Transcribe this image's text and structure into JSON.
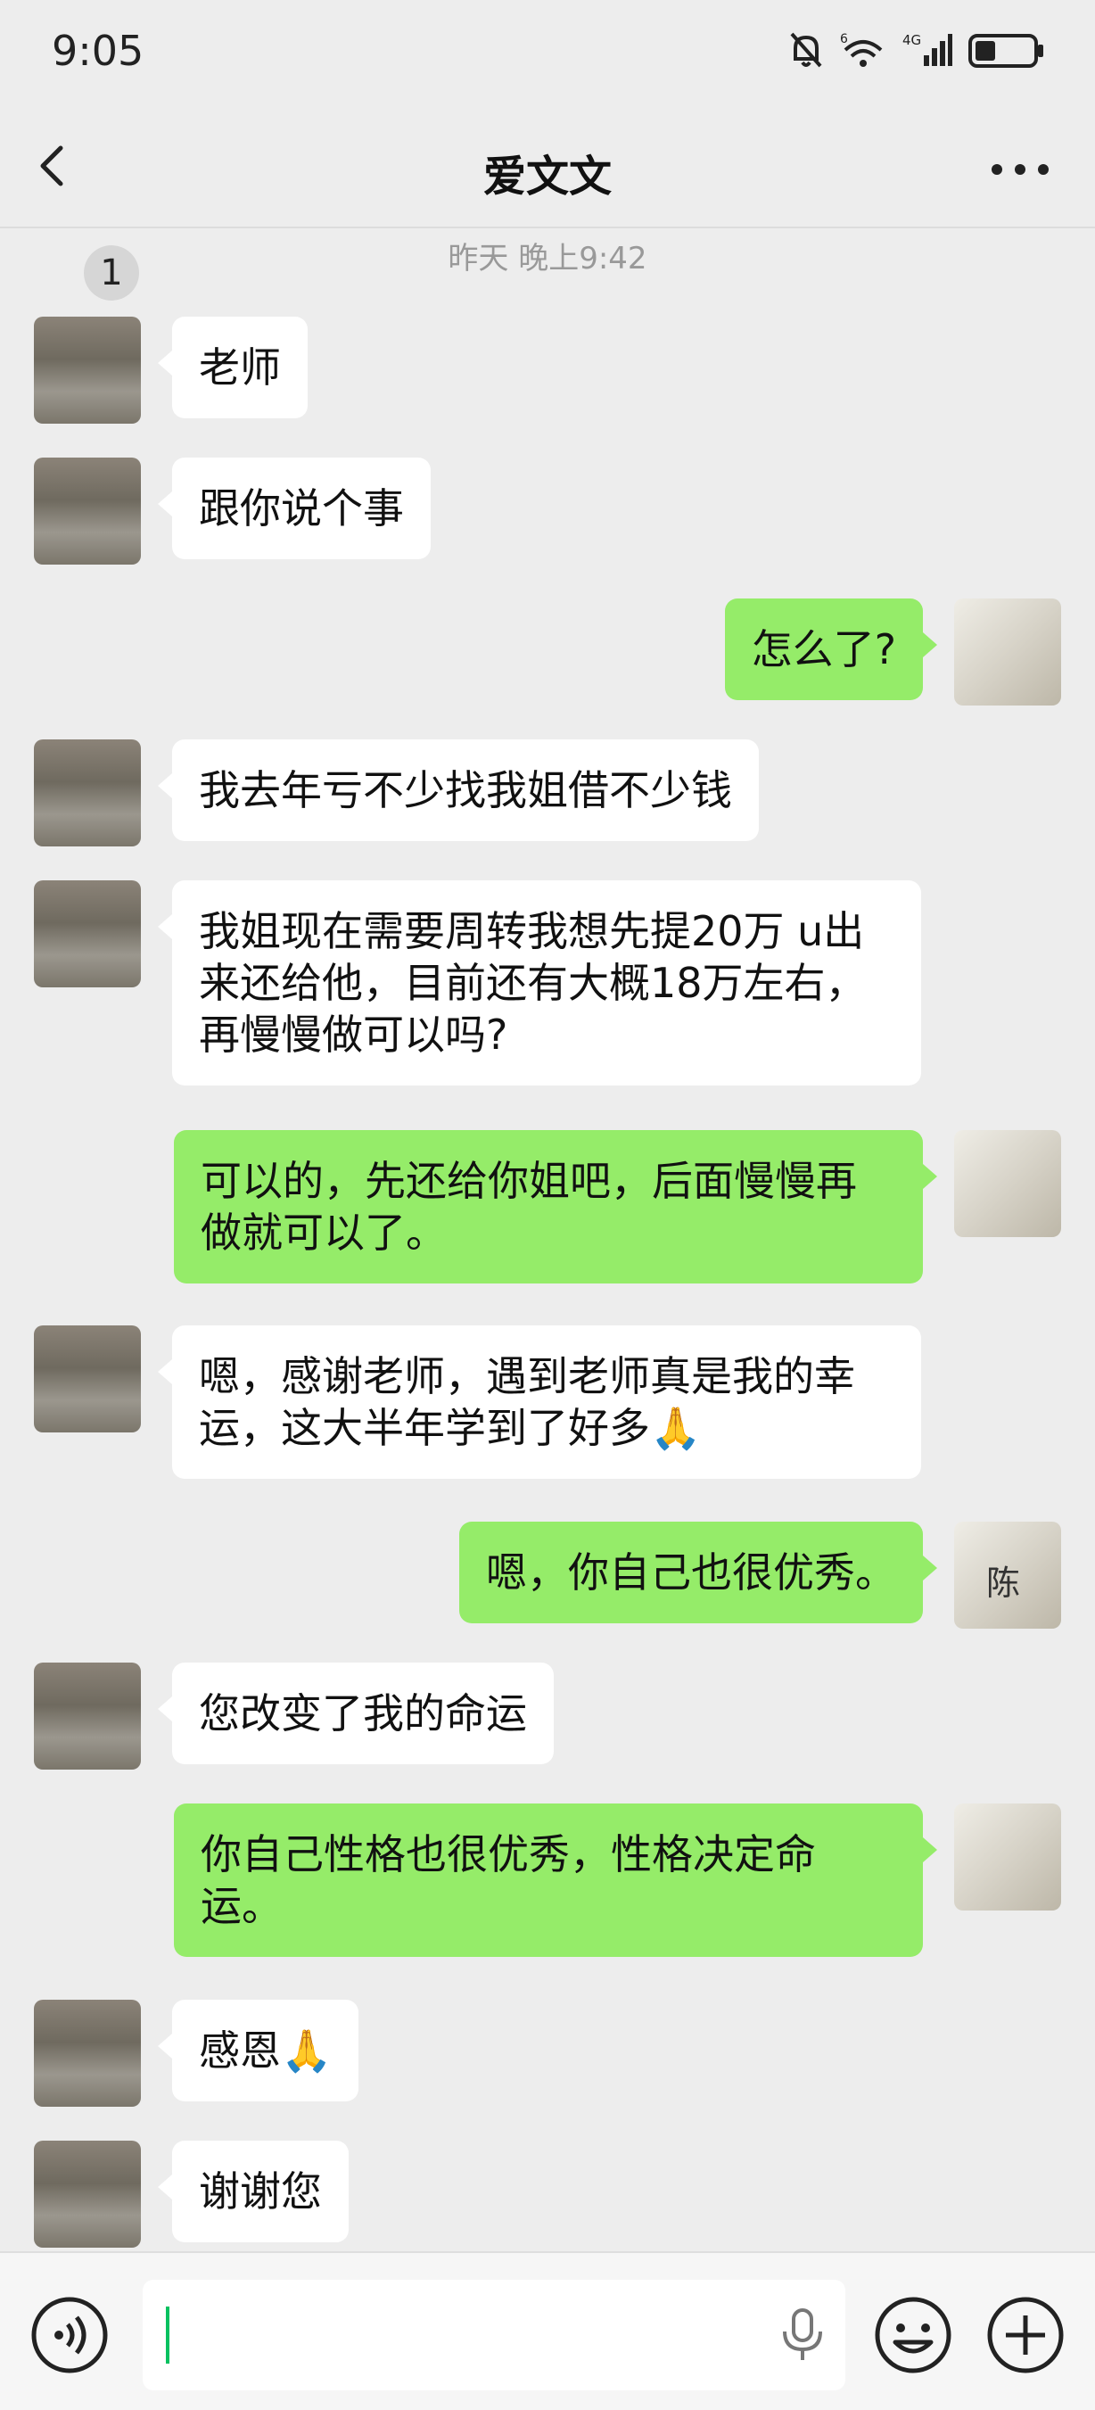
{
  "status_bar": {
    "time": "9:05",
    "battery_level": 0.35
  },
  "header": {
    "unread_count": "1",
    "title": "爱文文"
  },
  "timestamp": "昨天 晚上9:42",
  "messages": [
    {
      "side": "left",
      "text": "老师"
    },
    {
      "side": "left",
      "text": "跟你说个事"
    },
    {
      "side": "right",
      "text": "怎么了?"
    },
    {
      "side": "left",
      "text": "我去年亏不少找我姐借不少钱"
    },
    {
      "side": "left",
      "text": "我姐现在需要周转我想先提20万 u出来还给他，目前还有大概18万左右，再慢慢做可以吗?"
    },
    {
      "side": "right",
      "text": "可以的，先还给你姐吧，后面慢慢再做就可以了。"
    },
    {
      "side": "left",
      "text": "嗯，感谢老师，遇到老师真是我的幸运，这大半年学到了好多🙏"
    },
    {
      "side": "right",
      "text": "嗯，你自己也很优秀。"
    },
    {
      "side": "left",
      "text": "您改变了我的命运"
    },
    {
      "side": "right",
      "text": "你自己性格也很优秀，性格决定命运。"
    },
    {
      "side": "left",
      "text": "感恩🙏"
    },
    {
      "side": "left",
      "text": "谢谢您"
    }
  ],
  "right_avatar_char": "陈",
  "icons": {
    "back": "chevron-left-icon",
    "more": "more-dots-icon",
    "voice": "voice-icon",
    "mic": "microphone-icon",
    "emoji": "emoji-icon",
    "plus": "plus-icon"
  },
  "colors": {
    "sent_bubble": "#95ec69",
    "received_bubble": "#ffffff",
    "background": "#ededed",
    "caret": "#07c160"
  }
}
